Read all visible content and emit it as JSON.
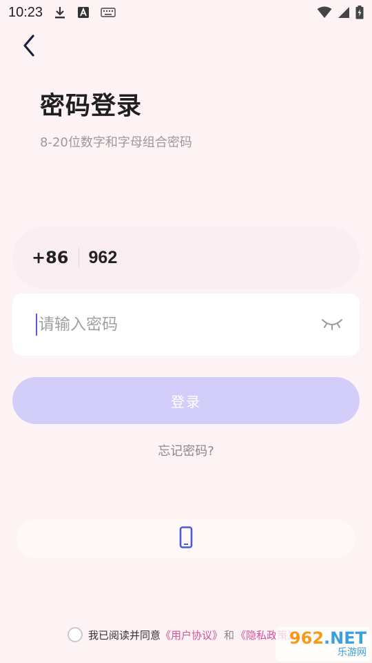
{
  "status_bar": {
    "time": "10:23",
    "icons": [
      "download-icon",
      "text-a-icon",
      "keyboard-icon",
      "wifi-icon",
      "cell-signal-icon",
      "battery-charging-icon"
    ]
  },
  "header": {
    "back_icon": "chevron-left-icon"
  },
  "title": "密码登录",
  "subtitle": "8-20位数字和字母组合密码",
  "phone": {
    "country_code": "+86",
    "number": "962"
  },
  "password": {
    "placeholder": "请输入密码",
    "value": "",
    "toggle_icon": "eye-closed-icon"
  },
  "login_button": "登录",
  "forgot_password": "忘记密码?",
  "alt_login": {
    "icon": "smartphone-icon",
    "color": "#4a5ad8"
  },
  "agreement": {
    "prefix": "我已阅读并同意",
    "user_agreement": "《用户协议》",
    "and": "和",
    "privacy_policy": "《隐私政策》"
  },
  "watermark": {
    "number": "962",
    "suffix": ".NET",
    "caption": "乐游网"
  },
  "colors": {
    "background": "#fdf3f4",
    "button_disabled": "#d3cdfa",
    "link": "#d8509a",
    "caret": "#5a57d8"
  }
}
